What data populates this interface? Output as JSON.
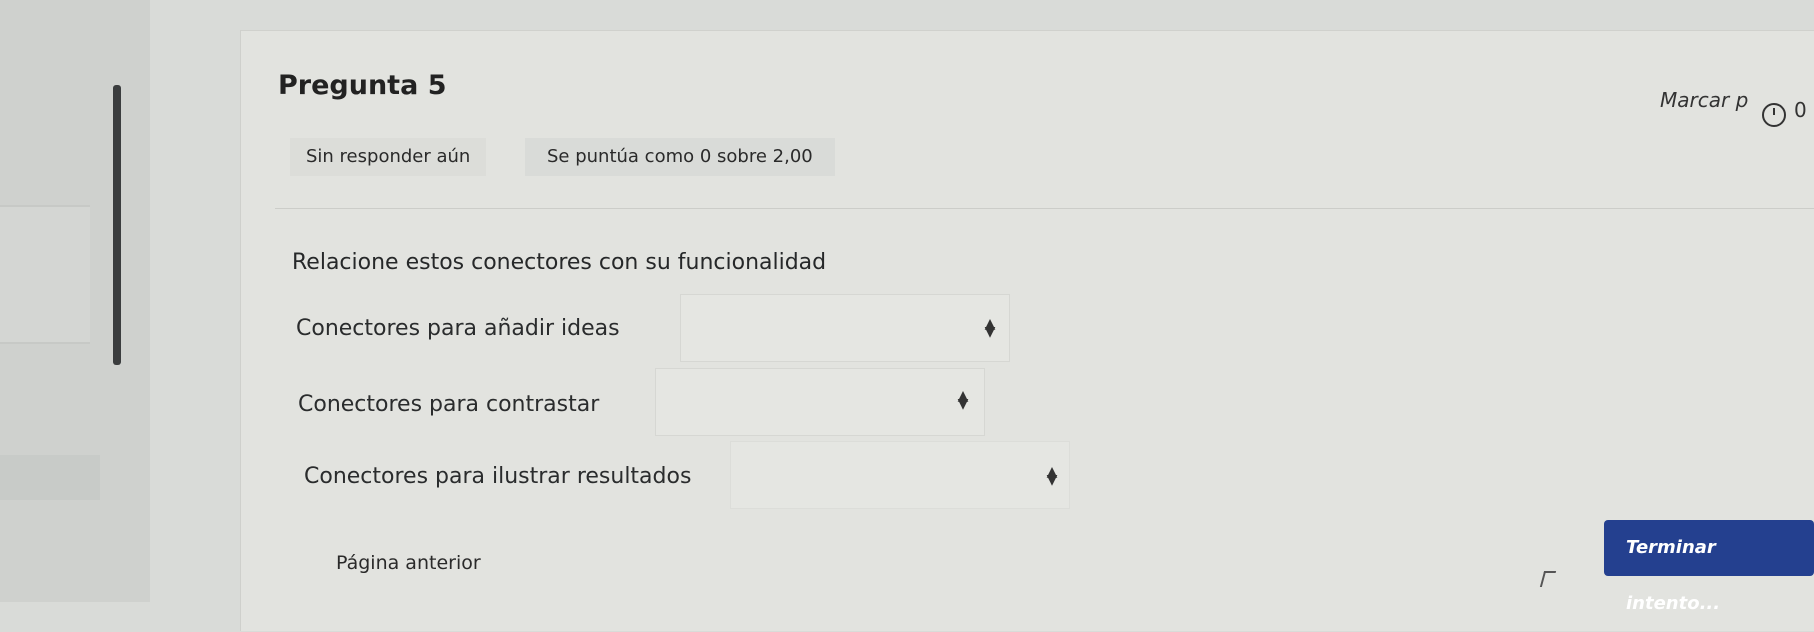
{
  "question": {
    "title": "Pregunta 5",
    "status": "Sin responder aún",
    "grade": "Se puntúa como 0 sobre 2,00",
    "flag_label": "Marcar p",
    "flag_icon": "clock-icon",
    "timer_fragment": "0"
  },
  "prompt": "Relacione estos conectores con su funcionalidad",
  "rows": [
    {
      "label": "Conectores para añadir ideas",
      "selected": ""
    },
    {
      "label": "Conectores para contrastar",
      "selected": ""
    },
    {
      "label": "Conectores para ilustrar resultados",
      "selected": ""
    }
  ],
  "navigation": {
    "previous": "Página anterior",
    "finish": "Terminar intento..."
  },
  "colors": {
    "finish_button": "#24408f",
    "background": "#d9dbd8"
  }
}
